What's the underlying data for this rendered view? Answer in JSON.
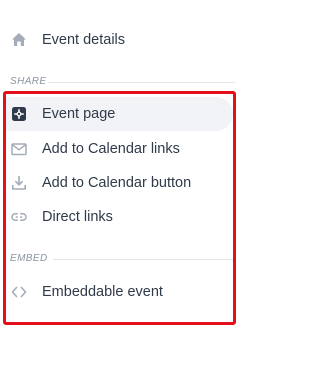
{
  "nav": {
    "event_details": {
      "label": "Event details",
      "icon": "home-icon"
    }
  },
  "share": {
    "section_label": "SHARE",
    "items": [
      {
        "label": "Event page",
        "icon": "event-page-icon",
        "active": true
      },
      {
        "label": "Add to Calendar links",
        "icon": "envelope-icon"
      },
      {
        "label": "Add to Calendar button",
        "icon": "download-icon"
      },
      {
        "label": "Direct links",
        "icon": "link-icon"
      }
    ]
  },
  "embed": {
    "section_label": "EMBED",
    "items": [
      {
        "label": "Embeddable event",
        "icon": "code-icon"
      }
    ]
  },
  "colors": {
    "highlight_border": "#e3101b",
    "active_background": "#f1f3f6",
    "text": "#2f3a4a",
    "icon_muted": "#a3acb8",
    "icon_active": "#2f3a4a"
  }
}
